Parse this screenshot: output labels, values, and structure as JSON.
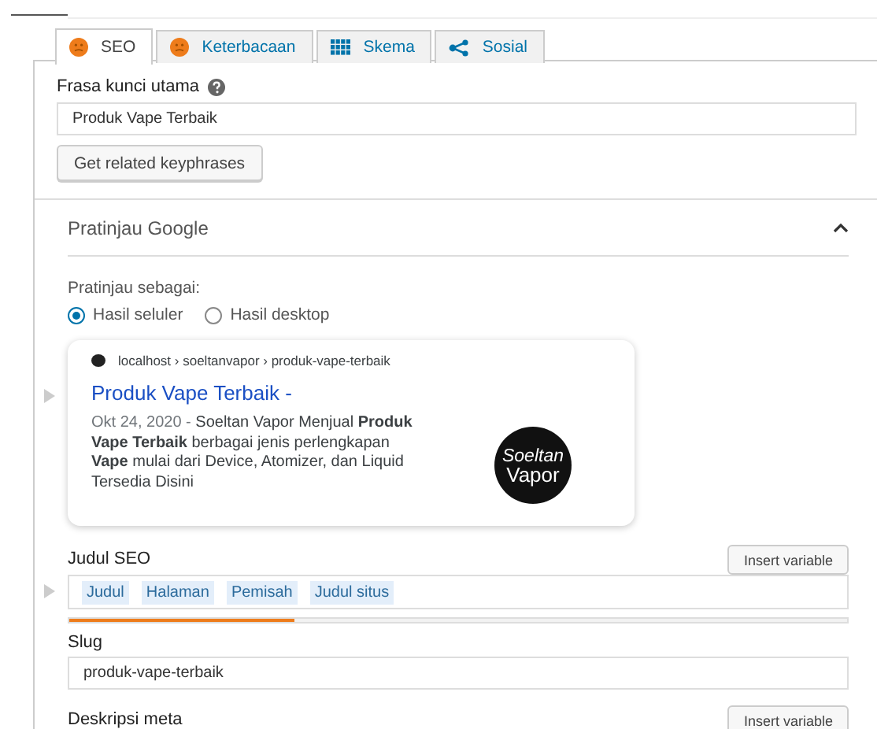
{
  "tabs": [
    {
      "label": "SEO",
      "kind": "score",
      "color": "#ee7c1b",
      "selected": true
    },
    {
      "label": "Keterbacaan",
      "kind": "score",
      "color": "#ee7c1b",
      "selected": false
    },
    {
      "label": "Skema",
      "kind": "grid",
      "selected": false
    },
    {
      "label": "Sosial",
      "kind": "share",
      "selected": false
    }
  ],
  "focus_keyphrase": {
    "label": "Frasa kunci utama",
    "value": "Produk Vape Terbaik",
    "button": "Get related keyphrases"
  },
  "google_preview": {
    "title": "Pratinjau Google",
    "expanded": true,
    "preview_as": "Pratinjau sebagai:",
    "options": [
      {
        "label": "Hasil seluler",
        "selected": true
      },
      {
        "label": "Hasil desktop",
        "selected": false
      }
    ],
    "snippet": {
      "breadcrumb": "localhost › soeltanvapor › produk-vape-terbaik",
      "title": "Produk Vape Terbaik -",
      "date": "Okt 24, 2020 -",
      "description": "Soeltan Vapor Menjual **Produk Vape Terbaik** berbagai jenis perlengkapan **Vape** mulai dari Device, Atomizer, dan Liquid Tersedia Disini",
      "logo_lines": [
        "Soeltan",
        "Vapor"
      ]
    }
  },
  "seo_title": {
    "label": "Judul SEO",
    "button": "Insert variable",
    "chips": [
      "Judul",
      "Halaman",
      "Pemisah",
      "Judul situs"
    ],
    "level": 0.29
  },
  "slug": {
    "label": "Slug",
    "value": "produk-vape-terbaik"
  },
  "meta_description": {
    "label": "Deskripsi meta",
    "button": "Insert variable"
  }
}
